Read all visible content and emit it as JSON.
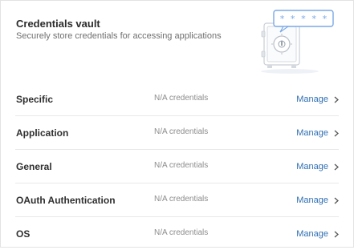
{
  "header": {
    "title": "Credentials vault",
    "subtitle": "Securely store credentials for accessing applications"
  },
  "illustration": {
    "icon": "vault-safe-icon",
    "password_mask": "* * * * *",
    "accent": "#7aa9e6"
  },
  "rows": [
    {
      "name": "Specific",
      "count": "N/A credentials",
      "action": "Manage"
    },
    {
      "name": "Application",
      "count": "N/A credentials",
      "action": "Manage"
    },
    {
      "name": "General",
      "count": "N/A credentials",
      "action": "Manage"
    },
    {
      "name": "OAuth Authentication",
      "count": "N/A credentials",
      "action": "Manage"
    },
    {
      "name": "OS",
      "count": "N/A credentials",
      "action": "Manage"
    }
  ],
  "colors": {
    "link": "#2f6fb3",
    "text": "#2f2f2f",
    "muted": "#8c8c8c",
    "divider": "#e8e8e8"
  }
}
